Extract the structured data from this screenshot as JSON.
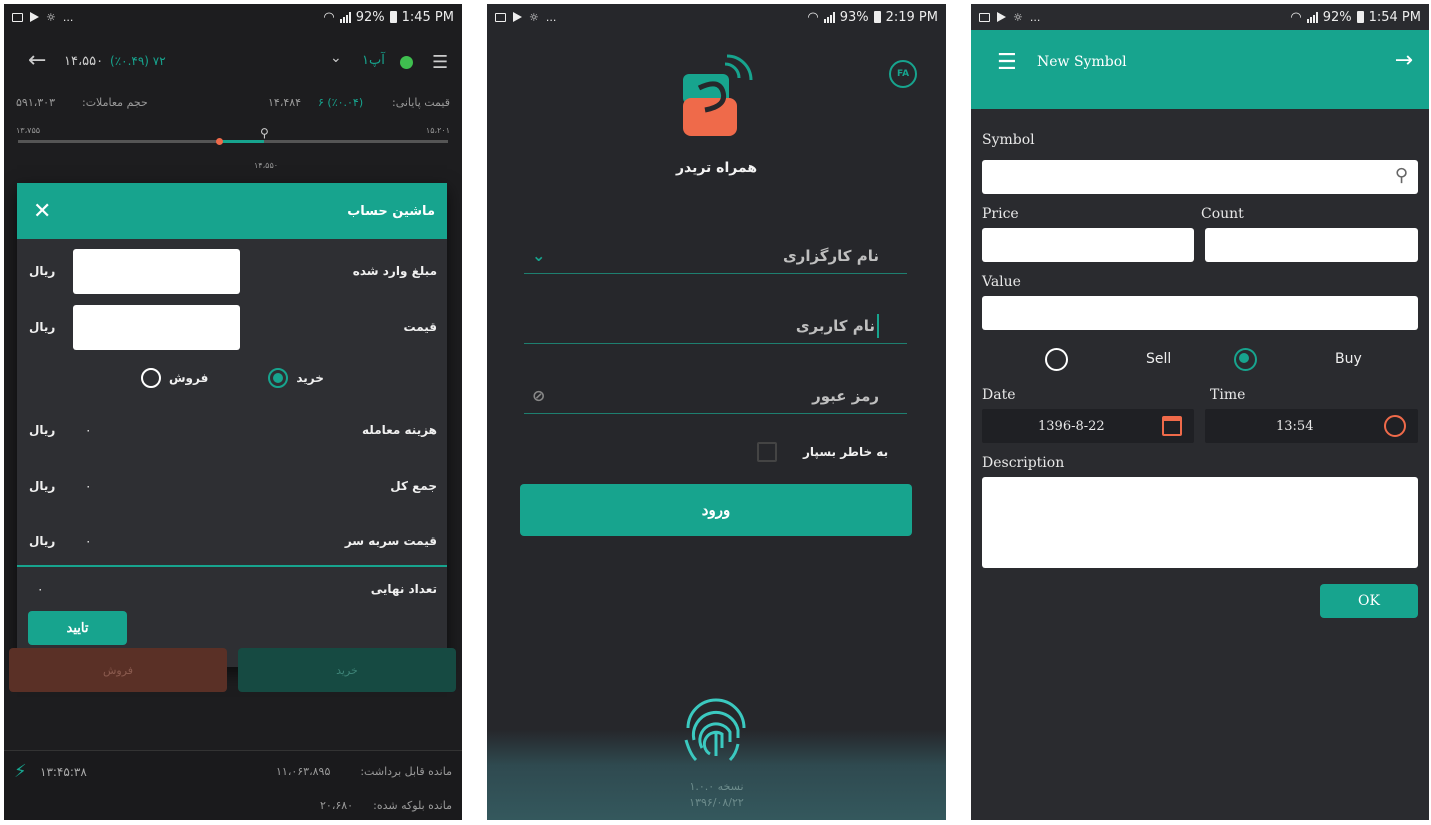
{
  "p1": {
    "status": {
      "left": "...",
      "battery": "92%",
      "time": "1:45 PM"
    },
    "header": {
      "price": "۱۴،۵۵۰",
      "change": "۷۲ (٪۰.۴۹)",
      "symbol": "آپ۱"
    },
    "info": {
      "last_price_label": "قیمت پایانی:",
      "last_price_value": "۱۴،۴۸۴",
      "last_price_change": "۶ (٪۰.۰۴)",
      "volume_label": "حجم معاملات:",
      "volume_value": "۵۹۱،۳۰۳"
    },
    "slider": {
      "min": "۱۳،۷۵۵",
      "max": "۱۵،۲۰۱",
      "mid": "۱۴،۵۵۰"
    },
    "dialog": {
      "title": "ماشین حساب",
      "entered_amount": "مبلغ وارد شده",
      "price": "قیمت",
      "rial": "ریال",
      "buy": "خرید",
      "sell": "فروش",
      "fee": "هزینه معامله",
      "total": "جمع کل",
      "breakeven": "قیمت سربه سر",
      "final_count": "تعداد نهایی",
      "zero": "۰",
      "confirm": "تایید"
    },
    "bottom": {
      "sell": "فروش",
      "buy": "خرید",
      "withdrawable_label": "مانده قابل برداشت:",
      "withdrawable_value": "۱۱،۰۶۳،۸۹۵",
      "time": "۱۳:۴۵:۳۸",
      "blocked_label": "مانده بلوکه شده:",
      "blocked_value": "۲۰،۶۸۰"
    }
  },
  "p2": {
    "status": {
      "left": "...",
      "battery": "93%",
      "time": "2:19 PM"
    },
    "lang": "FA",
    "app_name": "همراه تریدر",
    "broker": "نام کارگزاری",
    "username": "نام کاربری",
    "password": "رمز عبور",
    "remember": "به خاطر بسپار",
    "login": "ورود",
    "version": "نسخه ۱.۰.۰",
    "date": "۱۳۹۶/۰۸/۲۲"
  },
  "p3": {
    "status": {
      "left": "...",
      "battery": "92%",
      "time": "1:54 PM"
    },
    "title": "New Symbol",
    "symbol": "Symbol",
    "price": "Price",
    "count": "Count",
    "value": "Value",
    "sell": "Sell",
    "buy": "Buy",
    "date": "Date",
    "time": "Time",
    "date_value": "1396-8-22",
    "time_value": "13:54",
    "description": "Description",
    "ok": "OK"
  },
  "colors": {
    "teal": "#17a48e",
    "orange": "#ef6a4a",
    "dark": "#1d1d1f"
  }
}
